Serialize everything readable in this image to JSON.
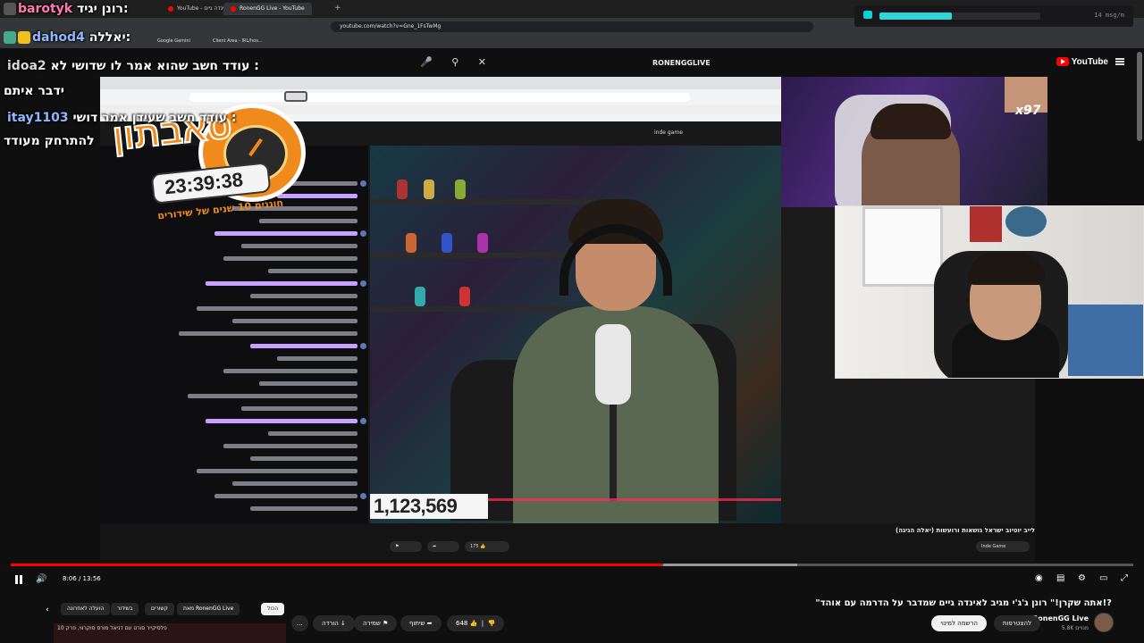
{
  "browser": {
    "tabs": [
      {
        "label": "YouTube - אינדה גיים",
        "active": false
      },
      {
        "label": "RonenGG Live - YouTube",
        "active": true
      }
    ],
    "new_tab": "+",
    "url": "youtube.com/watch?v=Gne_1FsTwMg",
    "bookmarks": [
      "Google Gemini",
      "Client Area - IRL/hos..."
    ]
  },
  "youtube_header": {
    "logo": "YouTube",
    "search_value": "RONENGGLIVE"
  },
  "chat_overlay": [
    {
      "user": "barotyk",
      "text": "רונן יגיד:",
      "user_color": "#ff7ab0"
    },
    {
      "user": "dahod4",
      "text": "יאללה:",
      "user_color": "#8fb8ff"
    },
    {
      "user": "idoa2",
      "text": "עודד חשב שהוא אמר לו שדושי לא :",
      "user_color": "#ffffff"
    },
    {
      "user": "",
      "text": "ידבר איתם",
      "user_color": "#ffffff"
    },
    {
      "user": "itay1103",
      "text": "עודד חשב שעידן אמר דושי :",
      "user_color": "#8fb8ff"
    },
    {
      "user": "",
      "text": "להתרחק מעודד",
      "user_color": "#ffffff"
    }
  ],
  "msg_widget": {
    "rate": "14 msg/m",
    "level": 0.45,
    "accent": "#33d6d6"
  },
  "stream_overlay": {
    "event_word": "סאבתון",
    "countdown": "23:39:38",
    "subtitle": "חוגגים 10 שנים של שידורים",
    "multiplier": "x97",
    "subscriber_count": "1,123,569",
    "inner_channel": "inde game"
  },
  "video_info": {
    "title": "לייב יוטיוב ישראל גושאות ורועשות (יאלה הגיגה)",
    "channel": "Inde Game",
    "likes": "175"
  },
  "player": {
    "current_time": "8:06",
    "duration": "13:56",
    "played_fraction": 0.58,
    "accent": "#ff0000"
  },
  "page": {
    "title": "\"אתה שקרן!\" רונן ג'ג'י מגיב לאינדה גיים שמדבר על הדרמה עם אוהד!?",
    "channel_name": "RonenGG Live",
    "subscribers": "5.8K מנויים",
    "subscribe_label": "להצטרפות",
    "join_label": "הרשמה למינוי",
    "like_count": "648",
    "share_label": "שיתוף",
    "save_label": "שמירה",
    "download_label": "הורדה",
    "more_label": "...",
    "chips": [
      {
        "label": "הכול",
        "active": true
      },
      {
        "label": "מאת RonenGG Live",
        "active": false
      },
      {
        "label": "הועלה על ידי",
        "active": false
      },
      {
        "label": "קשורים",
        "active": false
      },
      {
        "label": "בשידור",
        "active": false
      },
      {
        "label": "הועלה לאחרונה",
        "active": false
      }
    ],
    "related_title": "פלסיקייר סורט עם דניאל מורס סוקרווי, פרק 10"
  }
}
